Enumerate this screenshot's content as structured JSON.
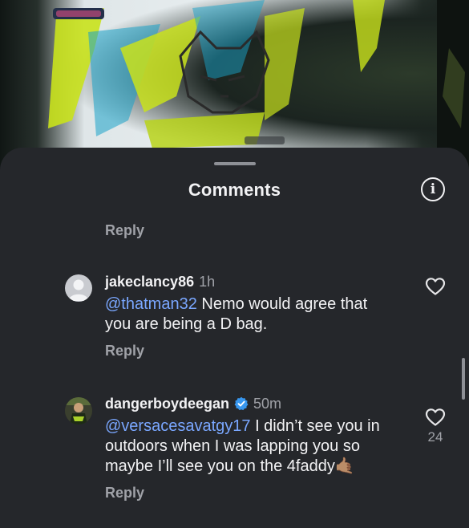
{
  "sheet": {
    "title": "Comments"
  },
  "top_reply": {
    "label": "Reply"
  },
  "comments": [
    {
      "username": "jakeclancy86",
      "time": "1h",
      "mention": "@thatman32",
      "text_line1": " Nemo would agree that",
      "text_line2": "you are being a D bag.",
      "reply_label": "Reply",
      "likes": ""
    },
    {
      "username": "dangerboydeegan",
      "verified": true,
      "time": "50m",
      "mention": "@versacesavatgy17",
      "text_line1": " I didn’t see you in",
      "text_line2": "outdoors when I was lapping you so",
      "text_line3": "maybe I’ll see you on the 4faddy",
      "emoji": "🤙🏽",
      "reply_label": "Reply",
      "likes": "24"
    }
  ],
  "colors": {
    "sheet_bg": "#25272b",
    "mention": "#7aa7ff",
    "verified": "#3797f0",
    "muted": "#a0a2a8"
  },
  "icons": [
    "info-icon",
    "heart-icon",
    "verified-badge-icon",
    "default-avatar-icon"
  ]
}
